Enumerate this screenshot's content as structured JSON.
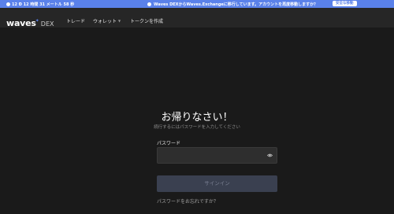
{
  "banner": {
    "timer_text": "12 Ð 12 時間 31 メートル 58 秒",
    "notice_text": "Waves DEXからWaves.Exchangeに移行しています。アカウントを再度移動しますか？",
    "migrate_label": "安全な移動",
    "color": "#5a81ea"
  },
  "header": {
    "logo_name": "waves",
    "logo_star": "✦",
    "logo_dex": "DEX",
    "nav": {
      "trade": "トレード",
      "wallet": "ウォレット",
      "create_token": "トークンを作成"
    }
  },
  "login": {
    "title": "お帰りなさい！",
    "subtitle": "続行するにはパスワードを入力してください",
    "password_label": "パスワード",
    "password_value": "",
    "signin_label": "サインイン",
    "forgot_label": "パスワードをお忘れですか？"
  }
}
